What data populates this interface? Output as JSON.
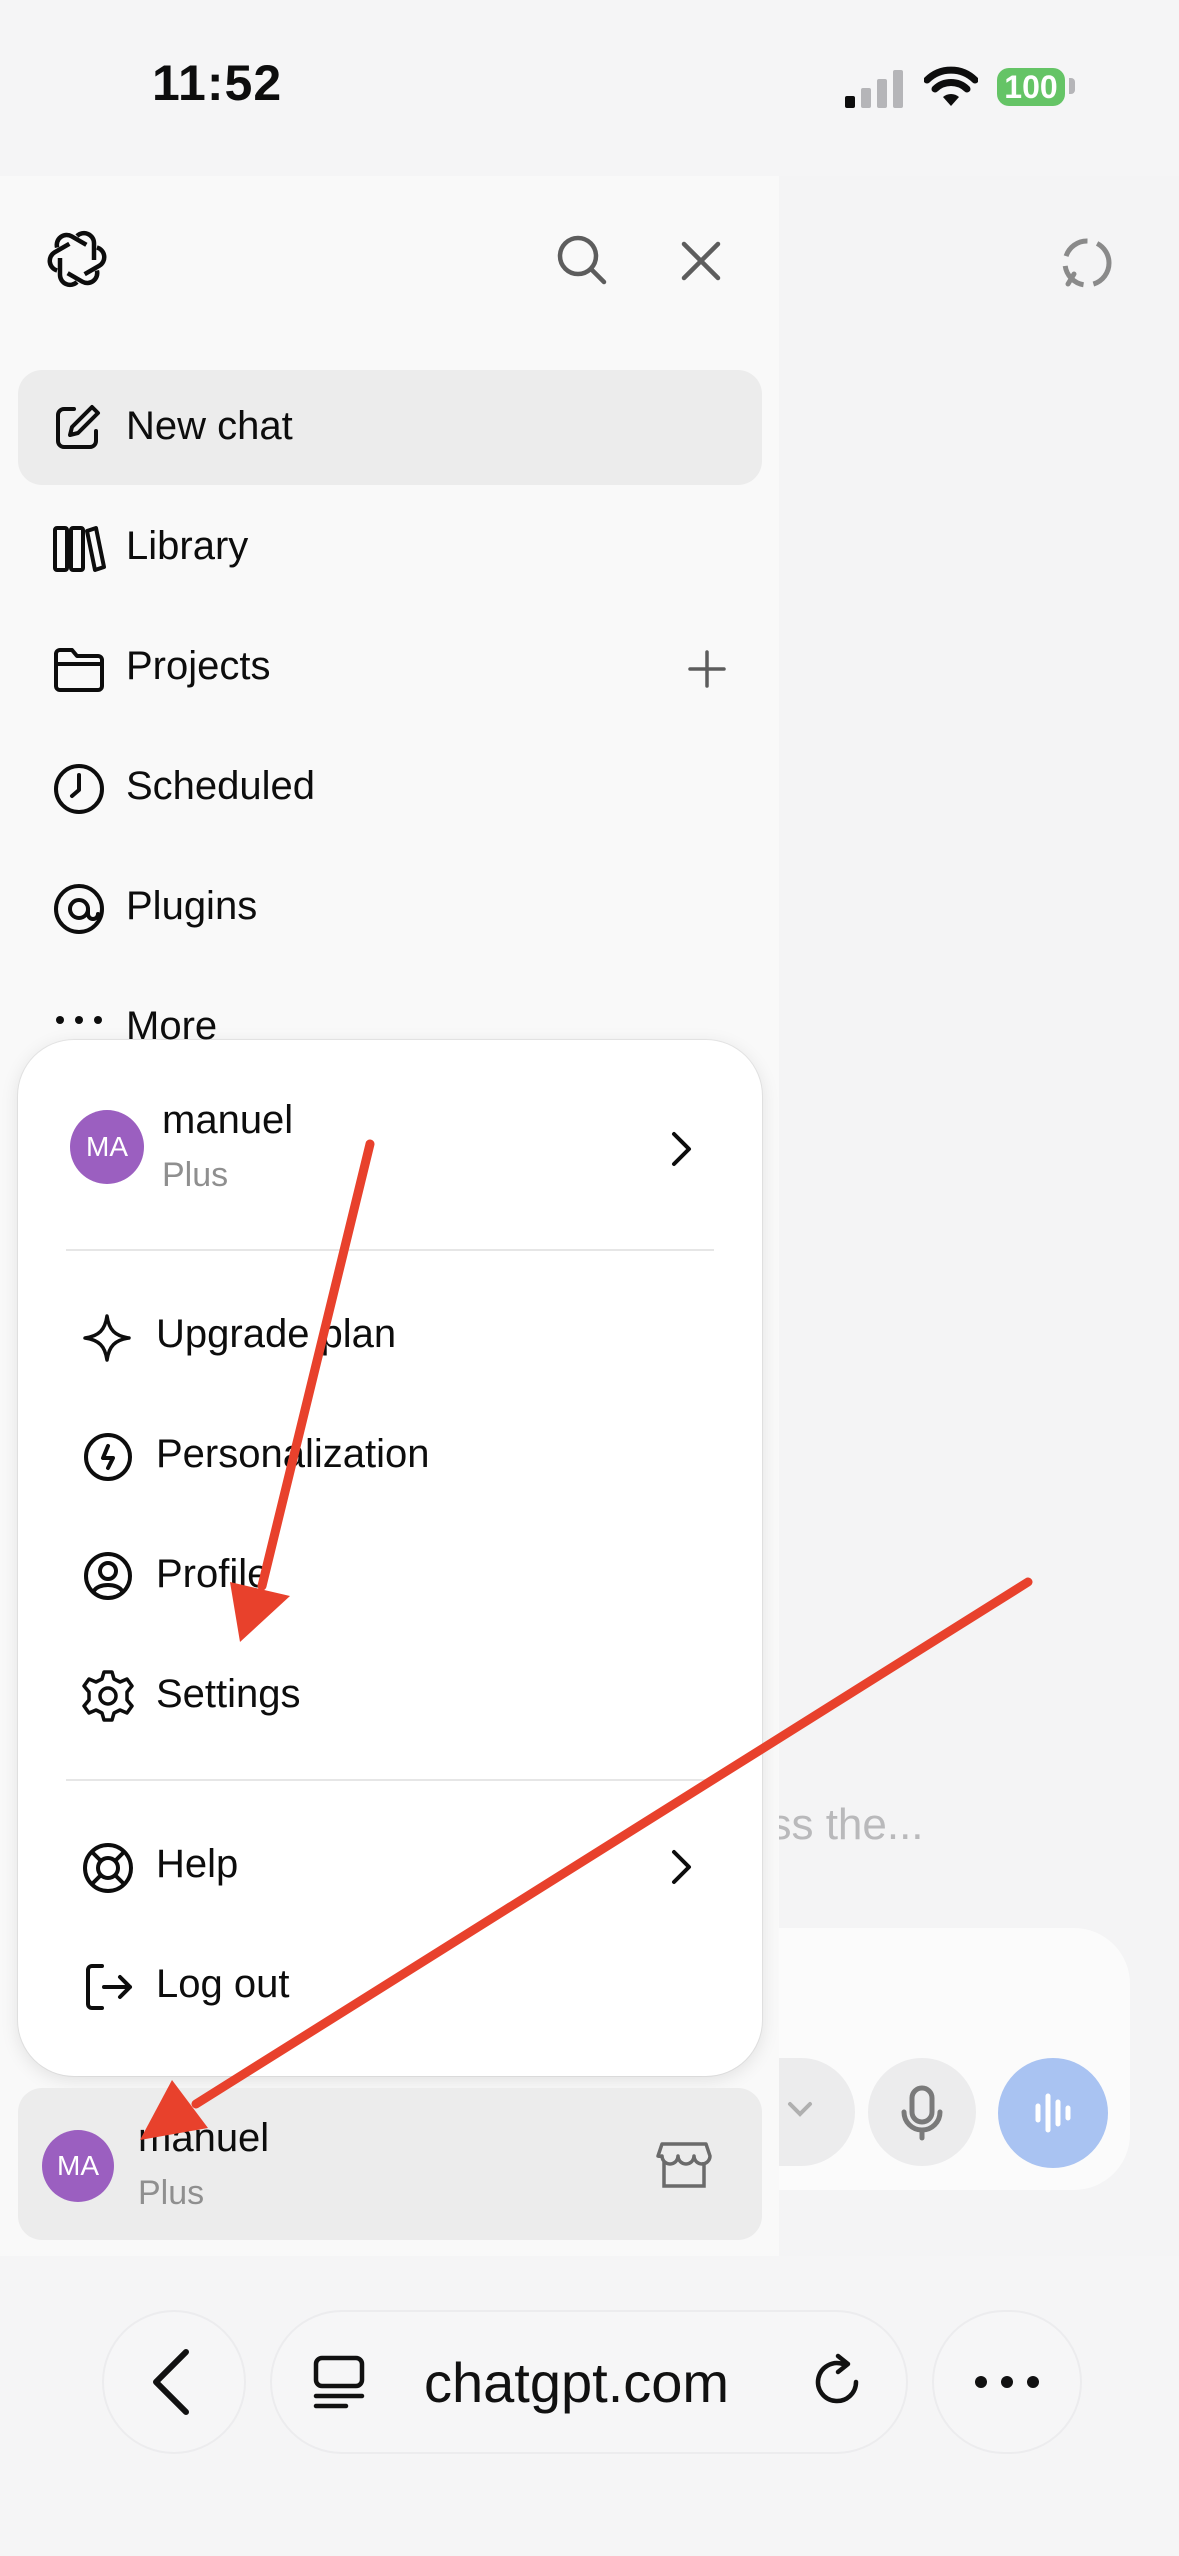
{
  "status_bar": {
    "time": "11:52",
    "battery": "100"
  },
  "main": {
    "hint_text": "ess the..."
  },
  "sidebar": {
    "new_chat": "New chat",
    "library": "Library",
    "projects": "Projects",
    "scheduled": "Scheduled",
    "plugins": "Plugins",
    "more": "More"
  },
  "menu": {
    "user": {
      "initials": "MA",
      "name": "manuel",
      "plan": "Plus"
    },
    "items": {
      "upgrade": "Upgrade plan",
      "personalization": "Personalization",
      "profile": "Profile",
      "settings": "Settings",
      "help": "Help",
      "logout": "Log out"
    }
  },
  "account": {
    "initials": "MA",
    "name": "manuel",
    "plan": "Plus"
  },
  "browser": {
    "url": "chatgpt.com"
  },
  "colors": {
    "accent_arrow": "#e8412c",
    "avatar": "#9b5fc0",
    "battery": "#65c466",
    "voice_button": "#a9c3f2"
  }
}
